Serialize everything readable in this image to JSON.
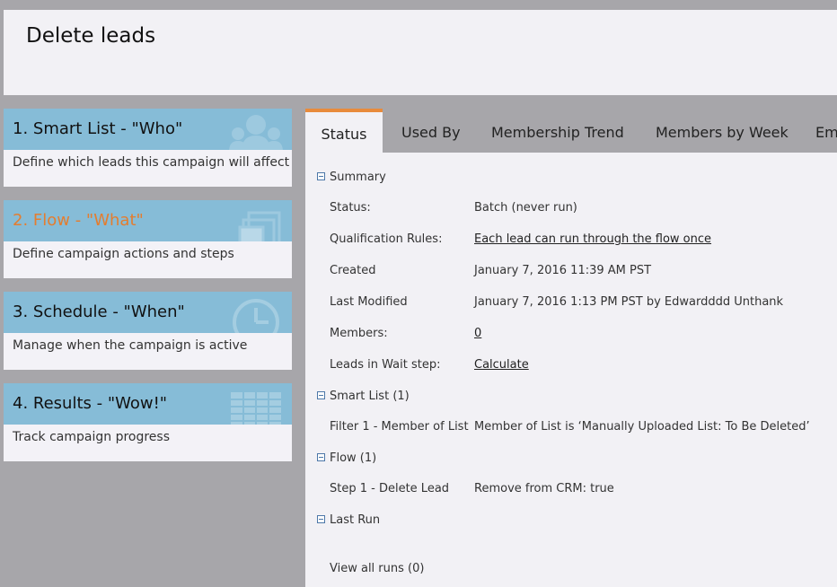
{
  "header": {
    "title": "Delete leads"
  },
  "steps": [
    {
      "title": "1. Smart List - \"Who\"",
      "description": "Define which leads this campaign will affect",
      "icon": "people-icon"
    },
    {
      "title": "2. Flow - \"What\"",
      "description": "Define campaign actions and steps",
      "icon": "stacked-pages-icon",
      "active": true
    },
    {
      "title": "3. Schedule - \"When\"",
      "description": "Manage when the campaign is active",
      "icon": "clock-icon"
    },
    {
      "title": "4. Results - \"Wow!\"",
      "description": "Track campaign progress",
      "icon": "table-icon"
    }
  ],
  "colors": {
    "step_header": "#86bcd7",
    "active_step": "#e47d2f",
    "tab_accent": "#e88b3c",
    "background": "#a7a6aa",
    "panel": "#f2f1f5"
  },
  "tabs": [
    "Status",
    "Used By",
    "Membership Trend",
    "Members by Week",
    "Em"
  ],
  "active_tab": "Status",
  "summary": {
    "heading": "Summary",
    "rows": [
      {
        "label": "Status:",
        "value": "Batch (never run)"
      },
      {
        "label": "Qualification Rules:",
        "value": "Each lead can run through the flow once"
      },
      {
        "label": "Created",
        "value": "January 7, 2016 11:39 AM PST"
      },
      {
        "label": "Last Modified",
        "value": "January 7, 2016 1:13 PM PST by Edwardddd Unthank"
      },
      {
        "label": "Members:",
        "value": "0"
      },
      {
        "label": "Leads in Wait step:",
        "value": "Calculate"
      }
    ]
  },
  "smart_list": {
    "heading": "Smart List (1)",
    "rows": [
      {
        "label": "Filter 1 - Member of List",
        "value": "Member of List is ‘Manually Uploaded List: To Be Deleted’"
      }
    ]
  },
  "flow": {
    "heading": "Flow (1)",
    "rows": [
      {
        "label": "Step 1 - Delete Lead",
        "value": "Remove from CRM: true"
      }
    ]
  },
  "last_run": {
    "heading": "Last Run",
    "view_all": "View all runs (0)"
  }
}
